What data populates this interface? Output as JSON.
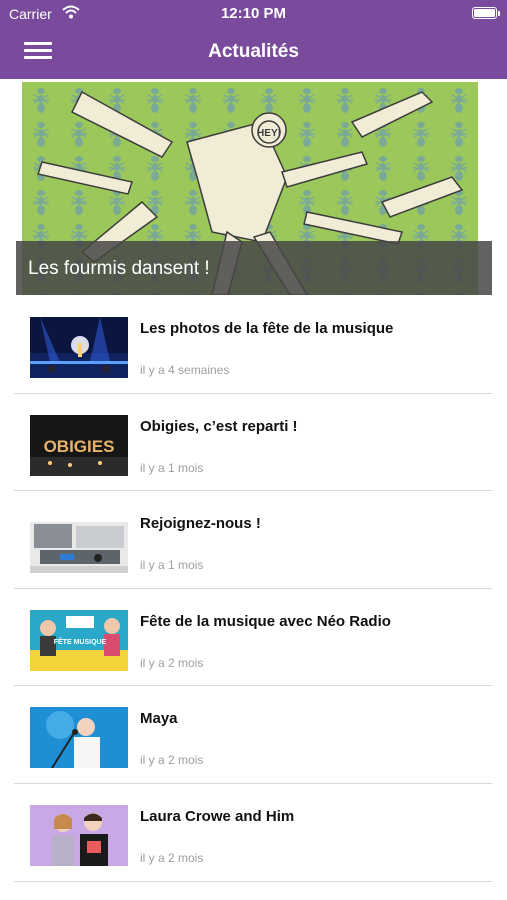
{
  "status": {
    "carrier": "Carrier",
    "time": "12:10 PM"
  },
  "header": {
    "title": "Actualités"
  },
  "hero": {
    "caption": "Les fourmis dansent !",
    "image_text": "HEY!"
  },
  "news": [
    {
      "title": "Les photos de la fête de la musique",
      "age": "il y a 4 semaines",
      "thumb": "concert-stage"
    },
    {
      "title": "Obigies, c’est reparti !",
      "age": "il y a 1 mois",
      "thumb": "obigies-sign",
      "thumb_text": "OBIGIES"
    },
    {
      "title": "Rejoignez-nous !",
      "age": "il y a 1 mois",
      "thumb": "radio-studio"
    },
    {
      "title": "Fête de la musique avec Néo Radio",
      "age": "il y a 2 mois",
      "thumb": "festival-poster",
      "thumb_text": "FÊTE MUSIQUE"
    },
    {
      "title": "Maya",
      "age": "il y a 2 mois",
      "thumb": "singer-blue"
    },
    {
      "title": "Laura Crowe and Him",
      "age": "il y a 2 mois",
      "thumb": "duo-portrait"
    }
  ],
  "colors": {
    "brand": "#7a4a9c",
    "hero_green": "#9cc85b",
    "divider": "#d9d9d9",
    "meta_text": "#9e9e9e"
  }
}
